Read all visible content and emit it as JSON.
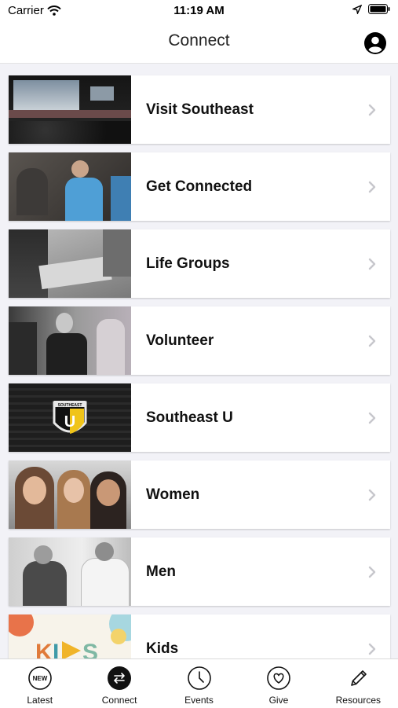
{
  "status": {
    "carrier": "Carrier",
    "time": "11:19 AM"
  },
  "header": {
    "title": "Connect"
  },
  "items": [
    {
      "label": "Visit Southeast",
      "image": "stage-worship-photo"
    },
    {
      "label": "Get Connected",
      "image": "people-greeting-photo"
    },
    {
      "label": "Life Groups",
      "image": "group-writing-photo"
    },
    {
      "label": "Volunteer",
      "image": "volunteer-photo"
    },
    {
      "label": "Southeast U",
      "image": "southeast-u-logo",
      "logo_text": "SOUTHEAST",
      "logo_letter": "U"
    },
    {
      "label": "Women",
      "image": "women-smiling-photo"
    },
    {
      "label": "Men",
      "image": "men-handshake-photo"
    },
    {
      "label": "Kids",
      "image": "kids-logo",
      "logo_text": "KIDS"
    }
  ],
  "tabs": [
    {
      "label": "Latest",
      "icon": "new-icon",
      "badge": "NEW"
    },
    {
      "label": "Connect",
      "icon": "connect-icon",
      "active": true
    },
    {
      "label": "Events",
      "icon": "clock-icon"
    },
    {
      "label": "Give",
      "icon": "heart-icon"
    },
    {
      "label": "Resources",
      "icon": "pen-icon"
    }
  ],
  "colors": {
    "background": "#f2f2f7",
    "card": "#ffffff",
    "chevron": "#c7c7cc",
    "active_tab": "#111111"
  }
}
